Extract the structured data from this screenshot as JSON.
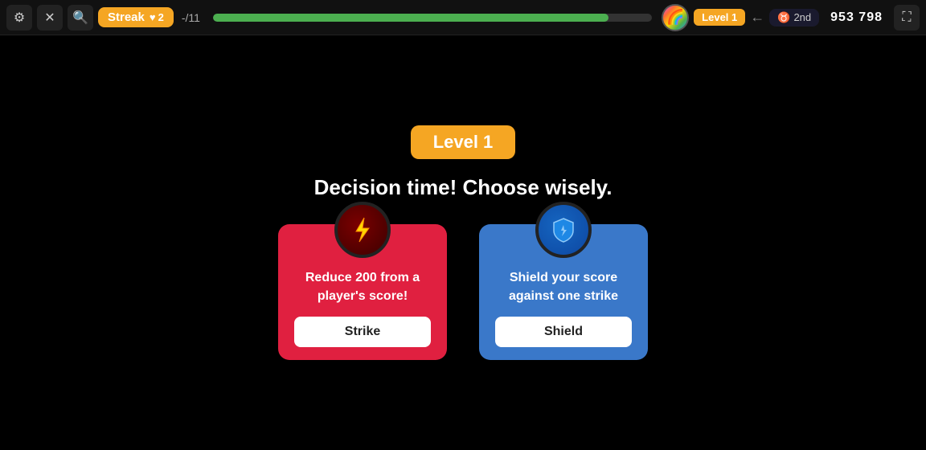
{
  "topbar": {
    "settings_label": "⚙",
    "flag_label": "✖",
    "zoom_label": "🔍",
    "streak_label": "Streak",
    "lives_count": "2",
    "lives_icon": "♥",
    "question_progress": "-/11",
    "progress_percent": 90,
    "level_badge": "Level 1",
    "rank_icon": "♉",
    "rank_text": "2nd",
    "score": "953 798",
    "fullscreen_icon": "⛶"
  },
  "main": {
    "level_title": "Level 1",
    "decision_text": "Decision time! Choose wisely.",
    "card_strike": {
      "description": "Reduce 200 from a player's score!",
      "button_label": "Strike"
    },
    "card_shield": {
      "description": "Shield your score against one strike",
      "button_label": "Shield"
    }
  }
}
